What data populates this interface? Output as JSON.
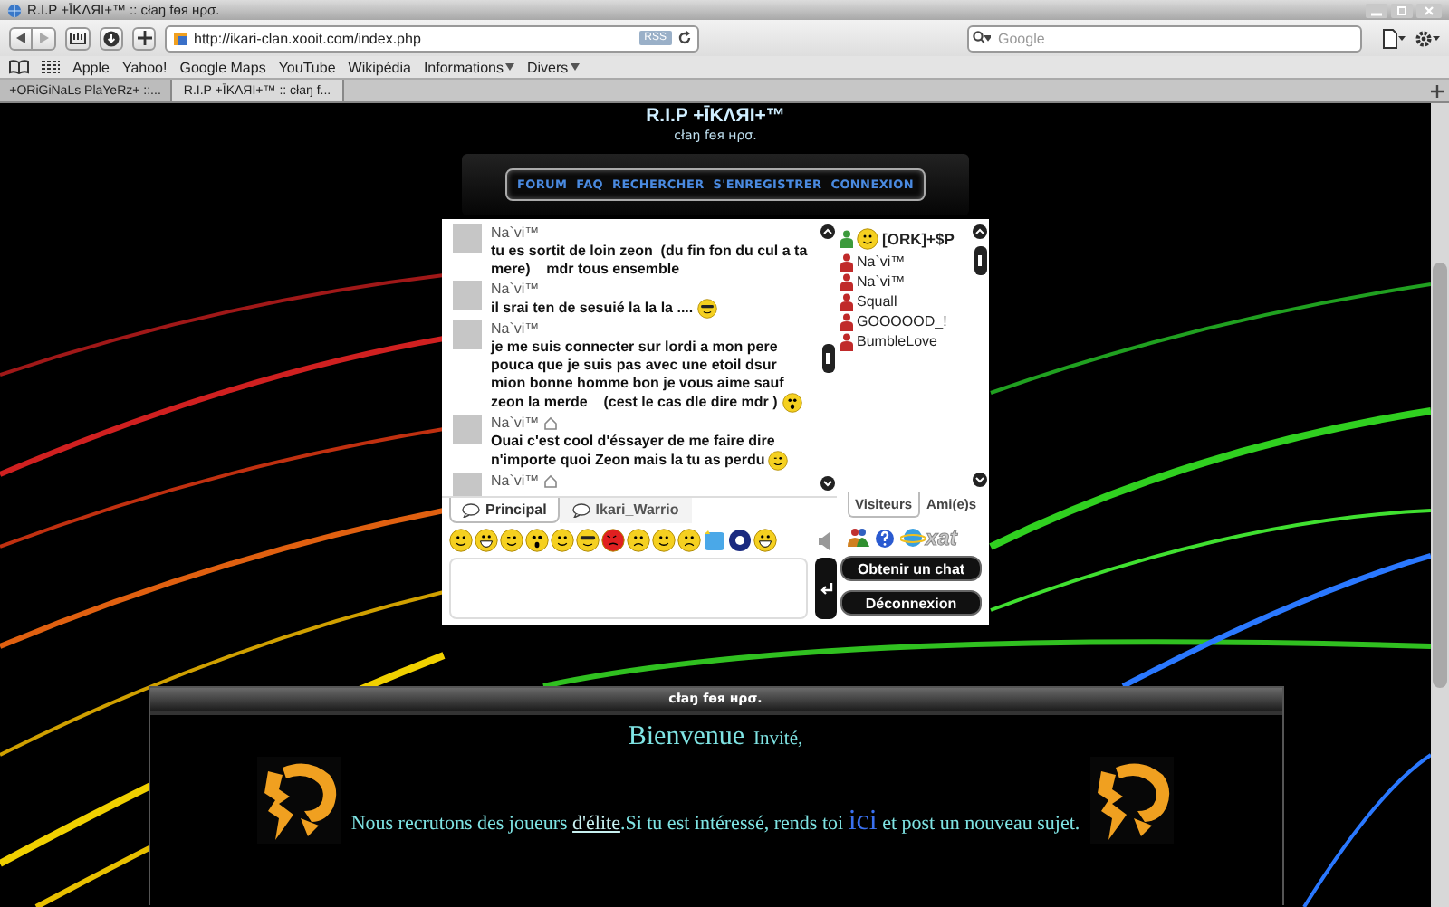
{
  "window": {
    "title": "R.I.P +ĪKΛЯI+™ :: cłaŋ fɵя нρσ."
  },
  "toolbar": {
    "address": "http://ikari-clan.xooit.com/index.php",
    "rss": "RSS",
    "search_placeholder": "Google"
  },
  "bookmarks": [
    {
      "label": "Apple",
      "kind": "link"
    },
    {
      "label": "Yahoo!",
      "kind": "link"
    },
    {
      "label": "Google Maps",
      "kind": "link"
    },
    {
      "label": "YouTube",
      "kind": "link"
    },
    {
      "label": "Wikipédia",
      "kind": "link"
    },
    {
      "label": "Informations",
      "kind": "menu"
    },
    {
      "label": "Divers",
      "kind": "menu"
    }
  ],
  "tabs": [
    {
      "label": "+ORiGiNaLs PlaYeRz+ ::...",
      "selected": false
    },
    {
      "label": "R.I.P +ĪKΛЯI+™ :: cłaŋ f...",
      "selected": true
    }
  ],
  "site": {
    "title": "R.I.P +ĪKΛЯI+™",
    "subtitle": "cłaŋ fɵя нρσ.",
    "nav": [
      "FORUM",
      "FAQ",
      "RECHERCHER",
      "S'ENREGISTRER",
      "CONNEXION"
    ]
  },
  "chat": {
    "messages": [
      {
        "user": "Na`vi™",
        "home_icon": false,
        "text": "tu es sortit de loin zeon  (du fin fon du cul a ta mere)    mdr tous ensemble",
        "kind": "plain"
      },
      {
        "user": "Na`vi™",
        "home_icon": false,
        "text": "il srai ten de sesuié la la la ....",
        "kind": "cool"
      },
      {
        "user": "Na`vi™",
        "home_icon": false,
        "text": "je me suis connecter sur lordi a mon pere pouca que je suis pas avec une etoil dsur mion bonne homme bon je vous aime sauf zeon la merde    (cest le cas dle dire mdr )",
        "kind": "surprised"
      },
      {
        "user": "Na`vi™",
        "home_icon": true,
        "text": "Ouai c'est cool d'éssayer de me faire dire n'importe quoi Zeon mais la tu as perdu",
        "kind": "wink"
      },
      {
        "user": "Na`vi™",
        "home_icon": true
      }
    ],
    "tabs": [
      {
        "label": "Principal",
        "selected": true
      },
      {
        "label": "Ikari_Warrio",
        "selected": false
      }
    ],
    "users": [
      {
        "name": "[ORK]+$P",
        "color": "#3c9a3c",
        "avatar": true
      },
      {
        "name": "Na`vi™",
        "color": "#c02a2a",
        "avatar": false
      },
      {
        "name": "Na`vi™",
        "color": "#c02a2a",
        "avatar": false
      },
      {
        "name": "Squall",
        "color": "#c02a2a",
        "avatar": false
      },
      {
        "name": "GOOOOOD_!",
        "color": "#c02a2a",
        "avatar": false
      },
      {
        "name": "BumbleLove",
        "color": "#c02a2a",
        "avatar": false
      }
    ],
    "user_tabs": [
      {
        "label": "Visiteurs",
        "selected": true
      },
      {
        "label": "Ami(e)s",
        "selected": false
      }
    ],
    "logo": "xat",
    "buttons": [
      "Obtenir un chat",
      "Déconnexion"
    ]
  },
  "welcome": {
    "header": "cłaŋ fɵя нρσ.",
    "greeting": "Bienvenue",
    "guest": "Invité,",
    "segments": [
      {
        "kind": "text",
        "text": "Nous recrutons des joueurs "
      },
      {
        "kind": "link",
        "text": "d'élite"
      },
      {
        "kind": "text",
        "text": ".Si tu est intéressé, rends toi "
      },
      {
        "kind": "big_link",
        "text": "ici"
      },
      {
        "kind": "text",
        "text": " et post un nouveau sujet."
      }
    ]
  }
}
